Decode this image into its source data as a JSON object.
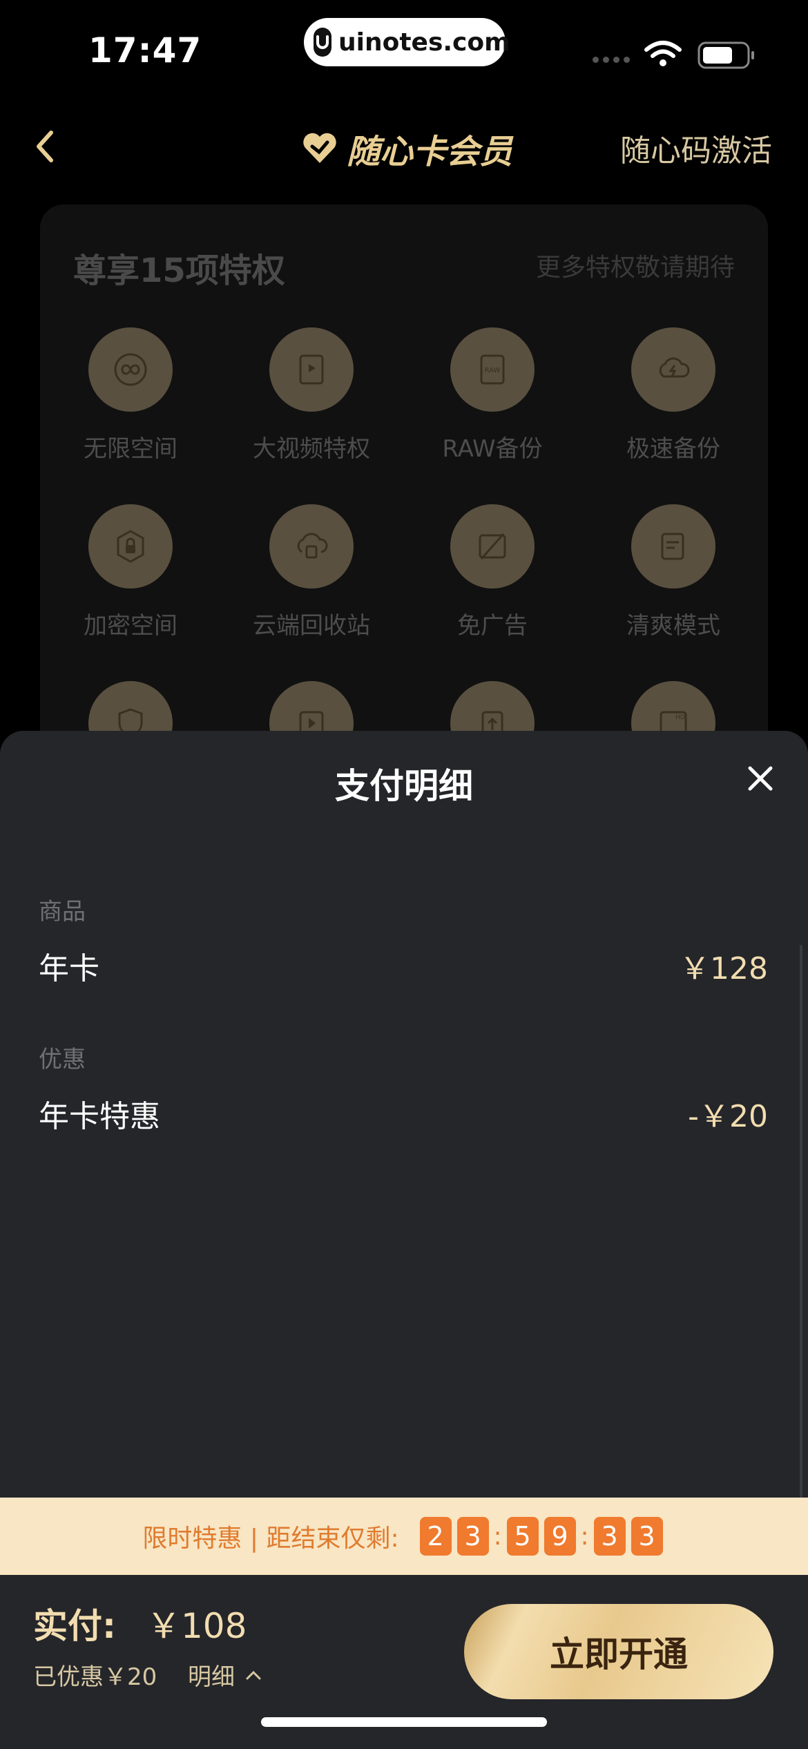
{
  "status_bar": {
    "time": "17:47",
    "url": "uinotes.com"
  },
  "header": {
    "title": "随心卡会员",
    "activate": "随心码激活"
  },
  "privileges": {
    "title": "尊享15项特权",
    "more": "更多特权敬请期待",
    "items": [
      {
        "label": "无限空间",
        "icon": "infinity-badge-icon"
      },
      {
        "label": "大视频特权",
        "icon": "video-file-icon"
      },
      {
        "label": "RAW备份",
        "icon": "raw-file-icon"
      },
      {
        "label": "极速备份",
        "icon": "lightning-cloud-icon"
      },
      {
        "label": "加密空间",
        "icon": "lock-hexagon-icon"
      },
      {
        "label": "云端回收站",
        "icon": "cloud-trash-icon"
      },
      {
        "label": "免广告",
        "icon": "no-ad-icon"
      },
      {
        "label": "清爽模式",
        "icon": "clean-mode-icon"
      },
      {
        "label": "",
        "icon": "shield-icon"
      },
      {
        "label": "",
        "icon": "play-icon"
      },
      {
        "label": "",
        "icon": "upload-file-icon"
      },
      {
        "label": "",
        "icon": "hd-image-icon"
      }
    ]
  },
  "sheet": {
    "title": "支付明细",
    "product_label": "商品",
    "product_name": "年卡",
    "product_price": "￥128",
    "discount_label": "优惠",
    "discount_name": "年卡特惠",
    "discount_value": "-￥20"
  },
  "promo": {
    "text": "限时特惠 | 距结束仅剩:",
    "countdown": [
      "2",
      "3",
      "5",
      "9",
      "3",
      "3"
    ]
  },
  "payment": {
    "label": "实付:",
    "amount": "￥108",
    "saved": "已优惠￥20",
    "detail": "明细",
    "cta": "立即开通"
  },
  "colors": {
    "accent_gold": "#F2DDB0",
    "promo_orange": "#F07A2E",
    "sheet_bg": "#25262A"
  }
}
